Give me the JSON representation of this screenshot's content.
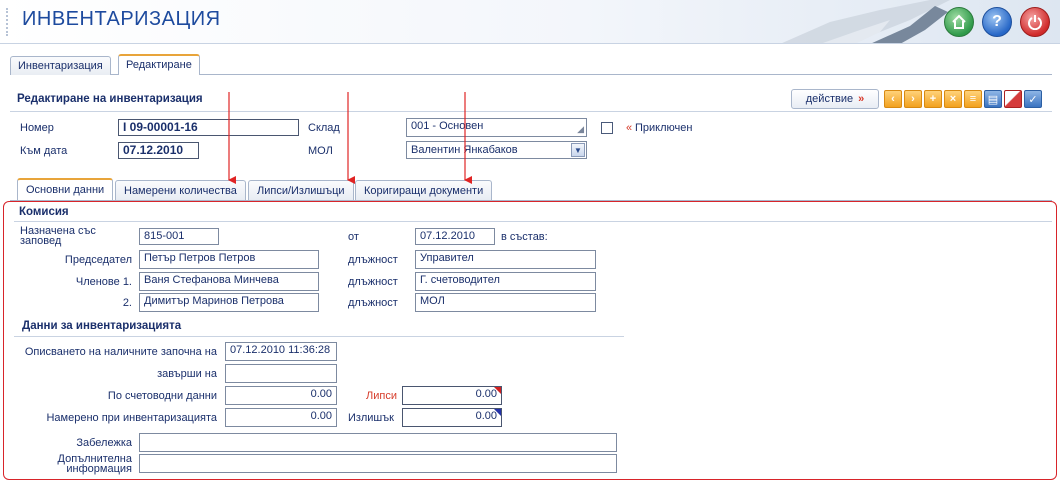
{
  "header": {
    "app_title": "ИНВЕНТАРИЗАЦИЯ",
    "buttons": {
      "home": "home-icon",
      "help": "?",
      "power": "power-icon"
    }
  },
  "top_tabs": [
    {
      "label": "Инвентаризация",
      "active": false
    },
    {
      "label": "Редактиране",
      "active": true
    }
  ],
  "panel": {
    "title": "Редактиране на инвентаризация",
    "action_label": "действие",
    "action_suffix": "»",
    "toolbar_icons": [
      "prev-icon",
      "next-icon",
      "add-icon",
      "delete-icon",
      "document-icon",
      "print-icon",
      "cancel-icon",
      "confirm-icon"
    ]
  },
  "form": {
    "number_label": "Номер",
    "number_value": "I 09-00001-16",
    "date_label": "Към дата",
    "date_value": "07.12.2010",
    "warehouse_label": "Склад",
    "warehouse_value": "001 - Основен",
    "mol_label": "МОЛ",
    "mol_value": "Валентин Янкабаков",
    "closed_prefix": "«",
    "closed_label": "Приключен"
  },
  "inner_tabs": [
    {
      "label": "Основни данни",
      "active": true
    },
    {
      "label": "Намерени количества",
      "active": false
    },
    {
      "label": "Липси/Излишъци",
      "active": false
    },
    {
      "label": "Коригиращи документи",
      "active": false
    }
  ],
  "commission": {
    "title": "Комисия",
    "appointed_label_1": "Назначена със",
    "appointed_label_2": "заповед",
    "appointed_value": "815-001",
    "from_label": "от",
    "from_value": "07.12.2010",
    "composition_label": "в състав:",
    "chairman_label": "Председател",
    "chairman_value": "Петър Петров Петров",
    "members_label": "Членове 1.",
    "member1_value": "Ваня Стефанова Минчева",
    "member2_label": "2.",
    "member2_value": "Димитър Маринов Петрова",
    "position_label": "длъжност",
    "position1_value": "Управител",
    "position2_value": "Г. счетоводител",
    "position3_value": "МОЛ"
  },
  "inventory": {
    "title": "Данни за инвентаризацията",
    "started_label": "Описването на наличните започна на",
    "started_value": "07.12.2010 11:36:28",
    "ended_label": "завърши на",
    "ended_value": "",
    "book_label": "По счетоводни данни",
    "book_value": "0.00",
    "shortage_label": "Липси",
    "shortage_value": "0.00",
    "found_label": "Намерено при инвентаризацията",
    "found_value": "0.00",
    "surplus_label": "Излишък",
    "surplus_value": "0.00",
    "note_label": "Забележка",
    "note_value": "",
    "extra_label_1": "Допълнителна",
    "extra_label_2": "информация",
    "extra_value": ""
  },
  "colors": {
    "accent_blue": "#1d4a9e",
    "tab_active_border": "#e8a43a",
    "highlight_red": "#d8242a"
  }
}
